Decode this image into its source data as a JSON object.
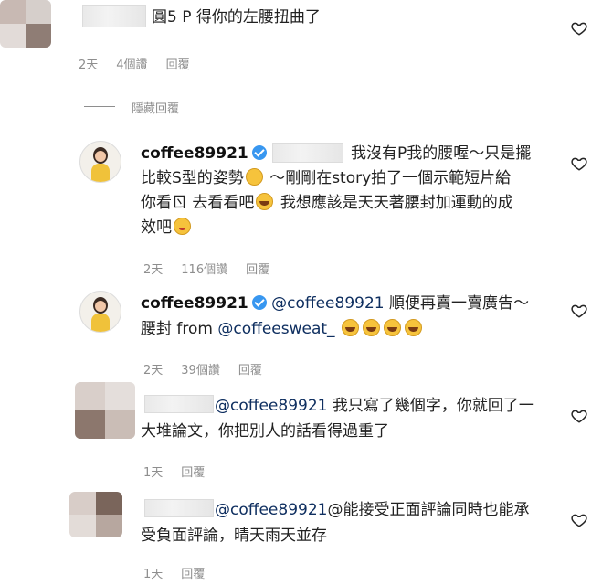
{
  "comments": [
    {
      "text_lines": [
        "圓5 P 得你的左腰扭曲了"
      ],
      "meta": {
        "time": "2天",
        "likes": "4個讚",
        "reply": "回覆"
      }
    }
  ],
  "hide_replies_label": "隱藏回覆",
  "replies": [
    {
      "handle": "coffee89921",
      "line1": "我沒有P我的腰喔～只是擺",
      "line2": "比較S型的姿勢",
      "line2b": "～剛剛在story拍了一個示範短片給",
      "line3a": "你看ㄖ 去看看吧",
      "line3b": "我想應該是天天著腰封加運動的成",
      "line4": "效吧",
      "meta": {
        "time": "2天",
        "likes": "116個讚",
        "reply": "回覆"
      }
    },
    {
      "handle": "coffee89921",
      "mention": "@coffee89921",
      "line1_rest": "順便再賣一賣廣告～",
      "line2a": "腰封 from",
      "line2_mention": "@coffeesweat_",
      "meta": {
        "time": "2天",
        "likes": "39個讚",
        "reply": "回覆"
      }
    },
    {
      "mention": "@coffee89921",
      "line1_rest": "我只寫了幾個字，你就回了一",
      "line2": "大堆論文，你把別人的話看得過重了",
      "meta": {
        "time": "1天",
        "reply": "回覆"
      }
    },
    {
      "mention": "@coffee89921",
      "line1_rest": "@能接受正面評論同時也能承",
      "line2": "受負面評論，晴天雨天並存",
      "meta": {
        "time": "1天",
        "reply": "回覆"
      }
    }
  ],
  "icons": {
    "like": "heart-icon",
    "verified": "verified-badge-icon"
  }
}
